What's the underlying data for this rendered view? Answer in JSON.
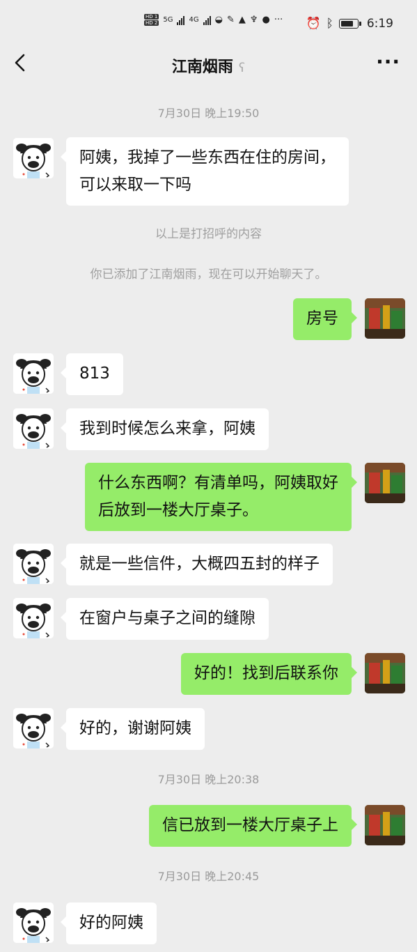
{
  "status_bar": {
    "hd1": "HD 1",
    "hd2": "HD 2",
    "net1": "5G",
    "net2": "4G",
    "time": "6:19"
  },
  "nav": {
    "title": "江南烟雨",
    "more": "···"
  },
  "chat": {
    "ts1": "7月30日 晚上19:50",
    "msg1_line1": "阿姨，我掉了一些东西在住的房间，",
    "msg1_line2": "可以来取一下吗",
    "sys1": "以上是打招呼的内容",
    "sys2": "你已添加了江南烟雨，现在可以开始聊天了。",
    "msg2": "房号",
    "msg3": "813",
    "msg4": "我到时候怎么来拿，阿姨",
    "msg5_line1": "什么东西啊？有清单吗，阿姨取好",
    "msg5_line2": "后放到一楼大厅桌子。",
    "msg6": "就是一些信件，大概四五封的样子",
    "msg7": "在窗户与桌子之间的缝隙",
    "msg8": "好的！找到后联系你",
    "msg9": "好的，谢谢阿姨",
    "ts2": "7月30日 晚上20:38",
    "msg10": "信已放到一楼大厅桌子上",
    "ts3": "7月30日 晚上20:45",
    "msg11": "好的阿姨"
  },
  "icons": {
    "back": "back-arrow-icon",
    "ear": "ear-icon",
    "more": "more-dots-icon",
    "avatar_left": "cartoon-face-avatar",
    "avatar_right": "photo-avatar"
  },
  "colors": {
    "background": "#ededed",
    "bubble_sent": "#95ec69",
    "bubble_received": "#ffffff",
    "meta_text": "#9a9a9a"
  }
}
